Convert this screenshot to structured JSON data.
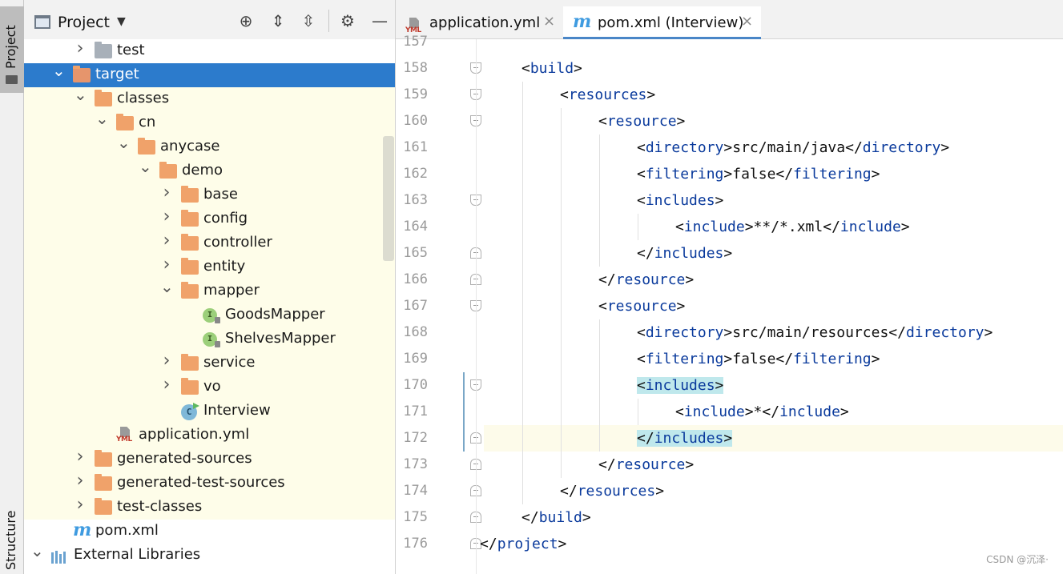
{
  "strip": {
    "project_label": "Project",
    "structure_label": "Structure"
  },
  "panel": {
    "title": "Project",
    "icons": [
      "project-window-icon",
      "chevron-down-icon",
      "locate-icon",
      "expand-all-icon",
      "collapse-all-icon",
      "gear-icon",
      "minimize-icon"
    ]
  },
  "tree": [
    {
      "label": "test",
      "icon": "folder-gray",
      "chevron": "right",
      "indent": 0,
      "tinted": false
    },
    {
      "label": "target",
      "icon": "folder-orange",
      "chevron": "down",
      "indent": -1,
      "selected": true
    },
    {
      "label": "classes",
      "icon": "folder-orange",
      "chevron": "down",
      "indent": 0,
      "tinted": true
    },
    {
      "label": "cn",
      "icon": "folder-orange",
      "chevron": "down",
      "indent": 1,
      "tinted": true
    },
    {
      "label": "anycase",
      "icon": "folder-orange",
      "chevron": "down",
      "indent": 2,
      "tinted": true
    },
    {
      "label": "demo",
      "icon": "folder-orange",
      "chevron": "down",
      "indent": 3,
      "tinted": true
    },
    {
      "label": "base",
      "icon": "folder-orange",
      "chevron": "right",
      "indent": 4,
      "tinted": true
    },
    {
      "label": "config",
      "icon": "folder-orange",
      "chevron": "right",
      "indent": 4,
      "tinted": true
    },
    {
      "label": "controller",
      "icon": "folder-orange",
      "chevron": "right",
      "indent": 4,
      "tinted": true
    },
    {
      "label": "entity",
      "icon": "folder-orange",
      "chevron": "right",
      "indent": 4,
      "tinted": true
    },
    {
      "label": "mapper",
      "icon": "folder-orange",
      "chevron": "down",
      "indent": 4,
      "tinted": true
    },
    {
      "label": "GoodsMapper",
      "icon": "interface",
      "chevron": "",
      "indent": 5,
      "tinted": true
    },
    {
      "label": "ShelvesMapper",
      "icon": "interface",
      "chevron": "",
      "indent": 5,
      "tinted": true
    },
    {
      "label": "service",
      "icon": "folder-orange",
      "chevron": "right",
      "indent": 4,
      "tinted": true
    },
    {
      "label": "vo",
      "icon": "folder-orange",
      "chevron": "right",
      "indent": 4,
      "tinted": true
    },
    {
      "label": "Interview",
      "icon": "class",
      "chevron": "",
      "indent": 4,
      "tinted": true
    },
    {
      "label": "application.yml",
      "icon": "yml",
      "chevron": "",
      "indent": 1,
      "tinted": true
    },
    {
      "label": "generated-sources",
      "icon": "folder-orange",
      "chevron": "right",
      "indent": 0,
      "tinted": true
    },
    {
      "label": "generated-test-sources",
      "icon": "folder-orange",
      "chevron": "right",
      "indent": 0,
      "tinted": true
    },
    {
      "label": "test-classes",
      "icon": "folder-orange",
      "chevron": "right",
      "indent": 0,
      "tinted": true
    },
    {
      "label": "pom.xml",
      "icon": "maven",
      "chevron": "",
      "indent": -1,
      "tinted": false
    },
    {
      "label": "External Libraries",
      "icon": "libraries",
      "chevron": "down",
      "indent": -2,
      "tinted": false
    }
  ],
  "tabs": [
    {
      "label": "application.yml",
      "icon": "yml",
      "active": false
    },
    {
      "label": "pom.xml (Interview)",
      "icon": "maven",
      "active": true
    }
  ],
  "editor": {
    "partial_line_number": "157",
    "lines": [
      {
        "n": "158",
        "indent": 1,
        "parts": [
          [
            "br",
            "<"
          ],
          [
            "tg",
            "build"
          ],
          [
            "br",
            ">"
          ]
        ],
        "fold": "open"
      },
      {
        "n": "159",
        "indent": 2,
        "parts": [
          [
            "br",
            "<"
          ],
          [
            "tg",
            "resources"
          ],
          [
            "br",
            ">"
          ]
        ],
        "fold": "open"
      },
      {
        "n": "160",
        "indent": 3,
        "parts": [
          [
            "br",
            "<"
          ],
          [
            "tg",
            "resource"
          ],
          [
            "br",
            ">"
          ]
        ],
        "fold": "open"
      },
      {
        "n": "161",
        "indent": 4,
        "parts": [
          [
            "br",
            "<"
          ],
          [
            "tg",
            "directory"
          ],
          [
            "br",
            ">src/main/java</"
          ],
          [
            "tg",
            "directory"
          ],
          [
            "br",
            ">"
          ]
        ],
        "fold": ""
      },
      {
        "n": "162",
        "indent": 4,
        "parts": [
          [
            "br",
            "<"
          ],
          [
            "tg",
            "filtering"
          ],
          [
            "br",
            ">false</"
          ],
          [
            "tg",
            "filtering"
          ],
          [
            "br",
            ">"
          ]
        ],
        "fold": ""
      },
      {
        "n": "163",
        "indent": 4,
        "parts": [
          [
            "br",
            "<"
          ],
          [
            "tg",
            "includes"
          ],
          [
            "br",
            ">"
          ]
        ],
        "fold": "open"
      },
      {
        "n": "164",
        "indent": 5,
        "parts": [
          [
            "br",
            "<"
          ],
          [
            "tg",
            "include"
          ],
          [
            "br",
            ">**/*.xml</"
          ],
          [
            "tg",
            "include"
          ],
          [
            "br",
            ">"
          ]
        ],
        "fold": ""
      },
      {
        "n": "165",
        "indent": 4,
        "parts": [
          [
            "br",
            "</"
          ],
          [
            "tg",
            "includes"
          ],
          [
            "br",
            ">"
          ]
        ],
        "fold": "close"
      },
      {
        "n": "166",
        "indent": 3,
        "parts": [
          [
            "br",
            "</"
          ],
          [
            "tg",
            "resource"
          ],
          [
            "br",
            ">"
          ]
        ],
        "fold": "close"
      },
      {
        "n": "167",
        "indent": 3,
        "parts": [
          [
            "br",
            "<"
          ],
          [
            "tg",
            "resource"
          ],
          [
            "br",
            ">"
          ]
        ],
        "fold": "open"
      },
      {
        "n": "168",
        "indent": 4,
        "parts": [
          [
            "br",
            "<"
          ],
          [
            "tg",
            "directory"
          ],
          [
            "br",
            ">src/main/resources</"
          ],
          [
            "tg",
            "directory"
          ],
          [
            "br",
            ">"
          ]
        ],
        "fold": ""
      },
      {
        "n": "169",
        "indent": 4,
        "parts": [
          [
            "br",
            "<"
          ],
          [
            "tg",
            "filtering"
          ],
          [
            "br",
            ">false</"
          ],
          [
            "tg",
            "filtering"
          ],
          [
            "br",
            ">"
          ]
        ],
        "fold": ""
      },
      {
        "n": "170",
        "indent": 4,
        "parts": [
          [
            "hl",
            "<includes>"
          ]
        ],
        "fold": "open"
      },
      {
        "n": "171",
        "indent": 5,
        "parts": [
          [
            "br",
            "<"
          ],
          [
            "tg",
            "include"
          ],
          [
            "br",
            ">*</"
          ],
          [
            "tg",
            "include"
          ],
          [
            "br",
            ">"
          ]
        ],
        "fold": ""
      },
      {
        "n": "172",
        "indent": 4,
        "parts": [
          [
            "hl",
            "</includes>"
          ]
        ],
        "fold": "close",
        "current": true
      },
      {
        "n": "173",
        "indent": 3,
        "parts": [
          [
            "br",
            "</"
          ],
          [
            "tg",
            "resource"
          ],
          [
            "br",
            ">"
          ]
        ],
        "fold": "close"
      },
      {
        "n": "174",
        "indent": 2,
        "parts": [
          [
            "br",
            "</"
          ],
          [
            "tg",
            "resources"
          ],
          [
            "br",
            ">"
          ]
        ],
        "fold": "close"
      },
      {
        "n": "175",
        "indent": 1,
        "parts": [
          [
            "br",
            "</"
          ],
          [
            "tg",
            "build"
          ],
          [
            "br",
            ">"
          ]
        ],
        "fold": "close"
      },
      {
        "n": "176",
        "indent": 0,
        "parts": [
          [
            "br",
            "</"
          ],
          [
            "tg",
            "project"
          ],
          [
            "br",
            ">"
          ]
        ],
        "fold": "close"
      }
    ]
  },
  "watermark": "CSDN @沉泽·"
}
